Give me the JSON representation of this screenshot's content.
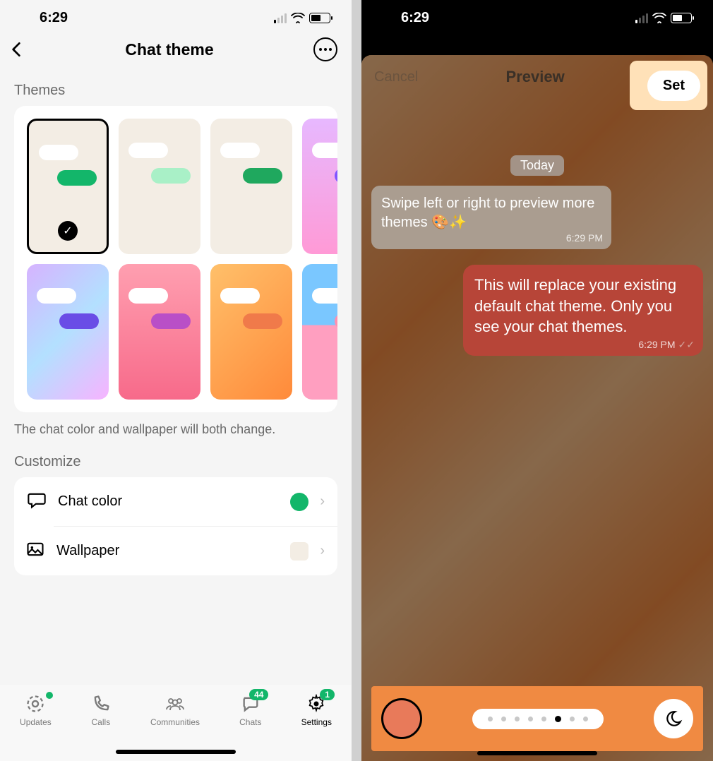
{
  "status": {
    "time": "6:29"
  },
  "left": {
    "header_title": "Chat theme",
    "themes_label": "Themes",
    "hint_text": "The chat color and wallpaper will both change.",
    "customize_label": "Customize",
    "chat_color_label": "Chat color",
    "wallpaper_label": "Wallpaper",
    "themes_row1": [
      {
        "bg": "doodle",
        "bubble": "#13b66a",
        "selected": true
      },
      {
        "bg": "doodle",
        "bubble": "#a9f0c7",
        "selected": false
      },
      {
        "bg": "doodle",
        "bubble": "#1fa85e",
        "selected": false
      },
      {
        "bg": "gradpink",
        "bubble": "#8055ff",
        "selected": false
      }
    ],
    "themes_row2": [
      {
        "bg": "holo",
        "bubble": "#6a4de6"
      },
      {
        "bg": "flower",
        "bubble": "#b94fc7"
      },
      {
        "bg": "orange",
        "bubble": "#f07a4a"
      },
      {
        "bg": "beach",
        "bubble": "#ff8fb0"
      }
    ],
    "tabs": [
      {
        "icon": "updates-icon",
        "label": "Updates",
        "dot": true
      },
      {
        "icon": "calls-icon",
        "label": "Calls"
      },
      {
        "icon": "communities-icon",
        "label": "Communities"
      },
      {
        "icon": "chats-icon",
        "label": "Chats",
        "badge": "44"
      },
      {
        "icon": "settings-icon",
        "label": "Settings",
        "active": true,
        "badge": "1"
      }
    ]
  },
  "right": {
    "cancel": "Cancel",
    "preview": "Preview",
    "set": "Set",
    "today": "Today",
    "msg1": "Swipe left or right to preview more themes 🎨✨",
    "msg1_time": "6:29 PM",
    "msg2": "This will replace your existing default chat theme. Only you see your chat themes.",
    "msg2_time": "6:29 PM",
    "pager_active_index": 5,
    "pager_total": 8
  }
}
